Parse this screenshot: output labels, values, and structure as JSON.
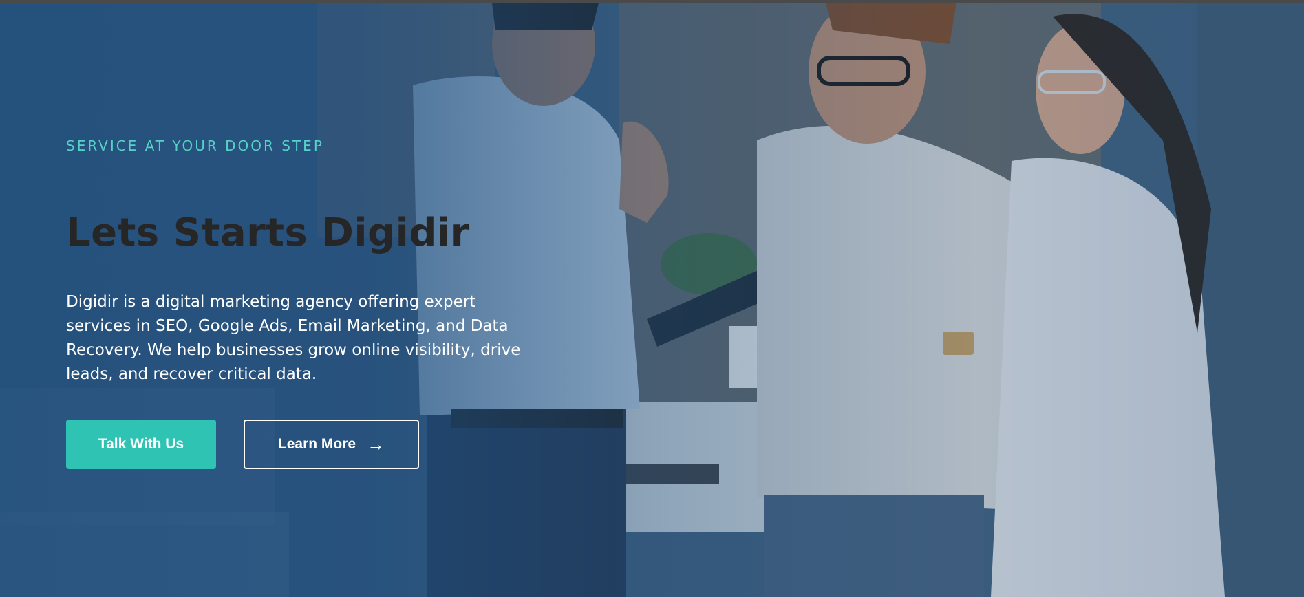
{
  "hero": {
    "eyebrow": "SERVICE AT YOUR DOOR STEP",
    "title": "Lets Starts Digidir",
    "description": "Digidir is a digital marketing agency offering expert services in SEO, Google Ads, Email Marketing, and Data Recovery. We help businesses grow online visibility, drive leads, and recover critical data.",
    "primary_button": "Talk With Us",
    "secondary_button": "Learn More",
    "secondary_icon": "→"
  },
  "colors": {
    "accent": "#2fc3b3",
    "eyebrow": "#55d2c7",
    "title": "#262626",
    "overlay": "#1f4e7d"
  },
  "icons": [
    "arrow-right-icon"
  ]
}
